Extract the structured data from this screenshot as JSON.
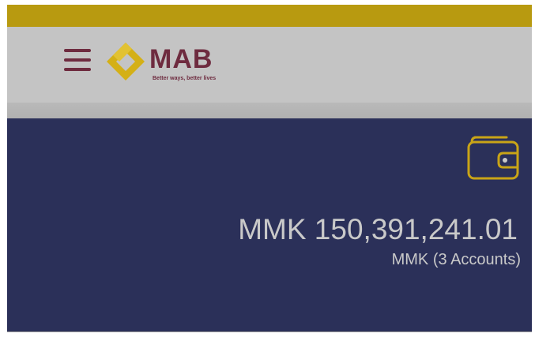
{
  "brand": {
    "name": "MAB",
    "tagline": "Better ways, better lives",
    "primary_color": "#6e2b3f",
    "accent_color": "#d4b017"
  },
  "header": {
    "menu_icon": "hamburger-menu-icon"
  },
  "balance": {
    "amount": "MMK 150,391,241.01",
    "subtitle": "MMK (3 Accounts)",
    "icon": "wallet-icon",
    "card_color": "#2b3059"
  }
}
